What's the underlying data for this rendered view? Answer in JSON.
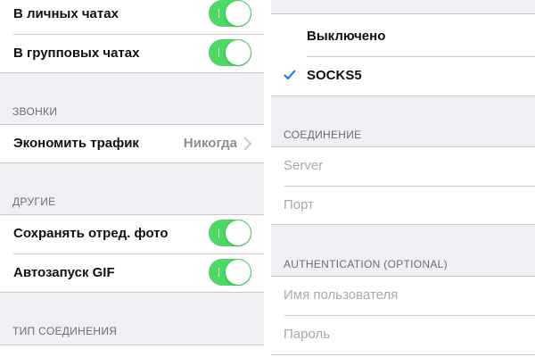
{
  "left_panel": {
    "privacy_rows": [
      {
        "label": "В личных чатах",
        "on": true
      },
      {
        "label": "В групповых чатах",
        "on": true
      }
    ],
    "calls": {
      "header": "ЗВОНКИ",
      "save_traffic_label": "Экономить трафик",
      "save_traffic_value": "Никогда"
    },
    "other": {
      "header": "ДРУГИЕ",
      "rows": [
        {
          "label": "Сохранять отред. фото",
          "on": true
        },
        {
          "label": "Автозапуск GIF",
          "on": true
        }
      ]
    },
    "connection_type_header": "ТИП СОЕДИНЕНИЯ"
  },
  "right_panel": {
    "proxy_options": [
      {
        "label": "Выключено",
        "selected": false
      },
      {
        "label": "SOCKS5",
        "selected": true
      }
    ],
    "connection": {
      "header": "СОЕДИНЕНИЕ",
      "server_placeholder": "Server",
      "port_placeholder": "Порт"
    },
    "authentication": {
      "header": "AUTHENTICATION (OPTIONAL)",
      "username_placeholder": "Имя пользователя",
      "password_placeholder": "Пароль"
    }
  },
  "colors": {
    "switch_on": "#4cd964",
    "checkmark": "#007aff",
    "background": "#efeff4",
    "separator": "#c8c7cc"
  },
  "icons": [
    "toggle-switch",
    "chevron-right-icon",
    "checkmark-icon"
  ]
}
